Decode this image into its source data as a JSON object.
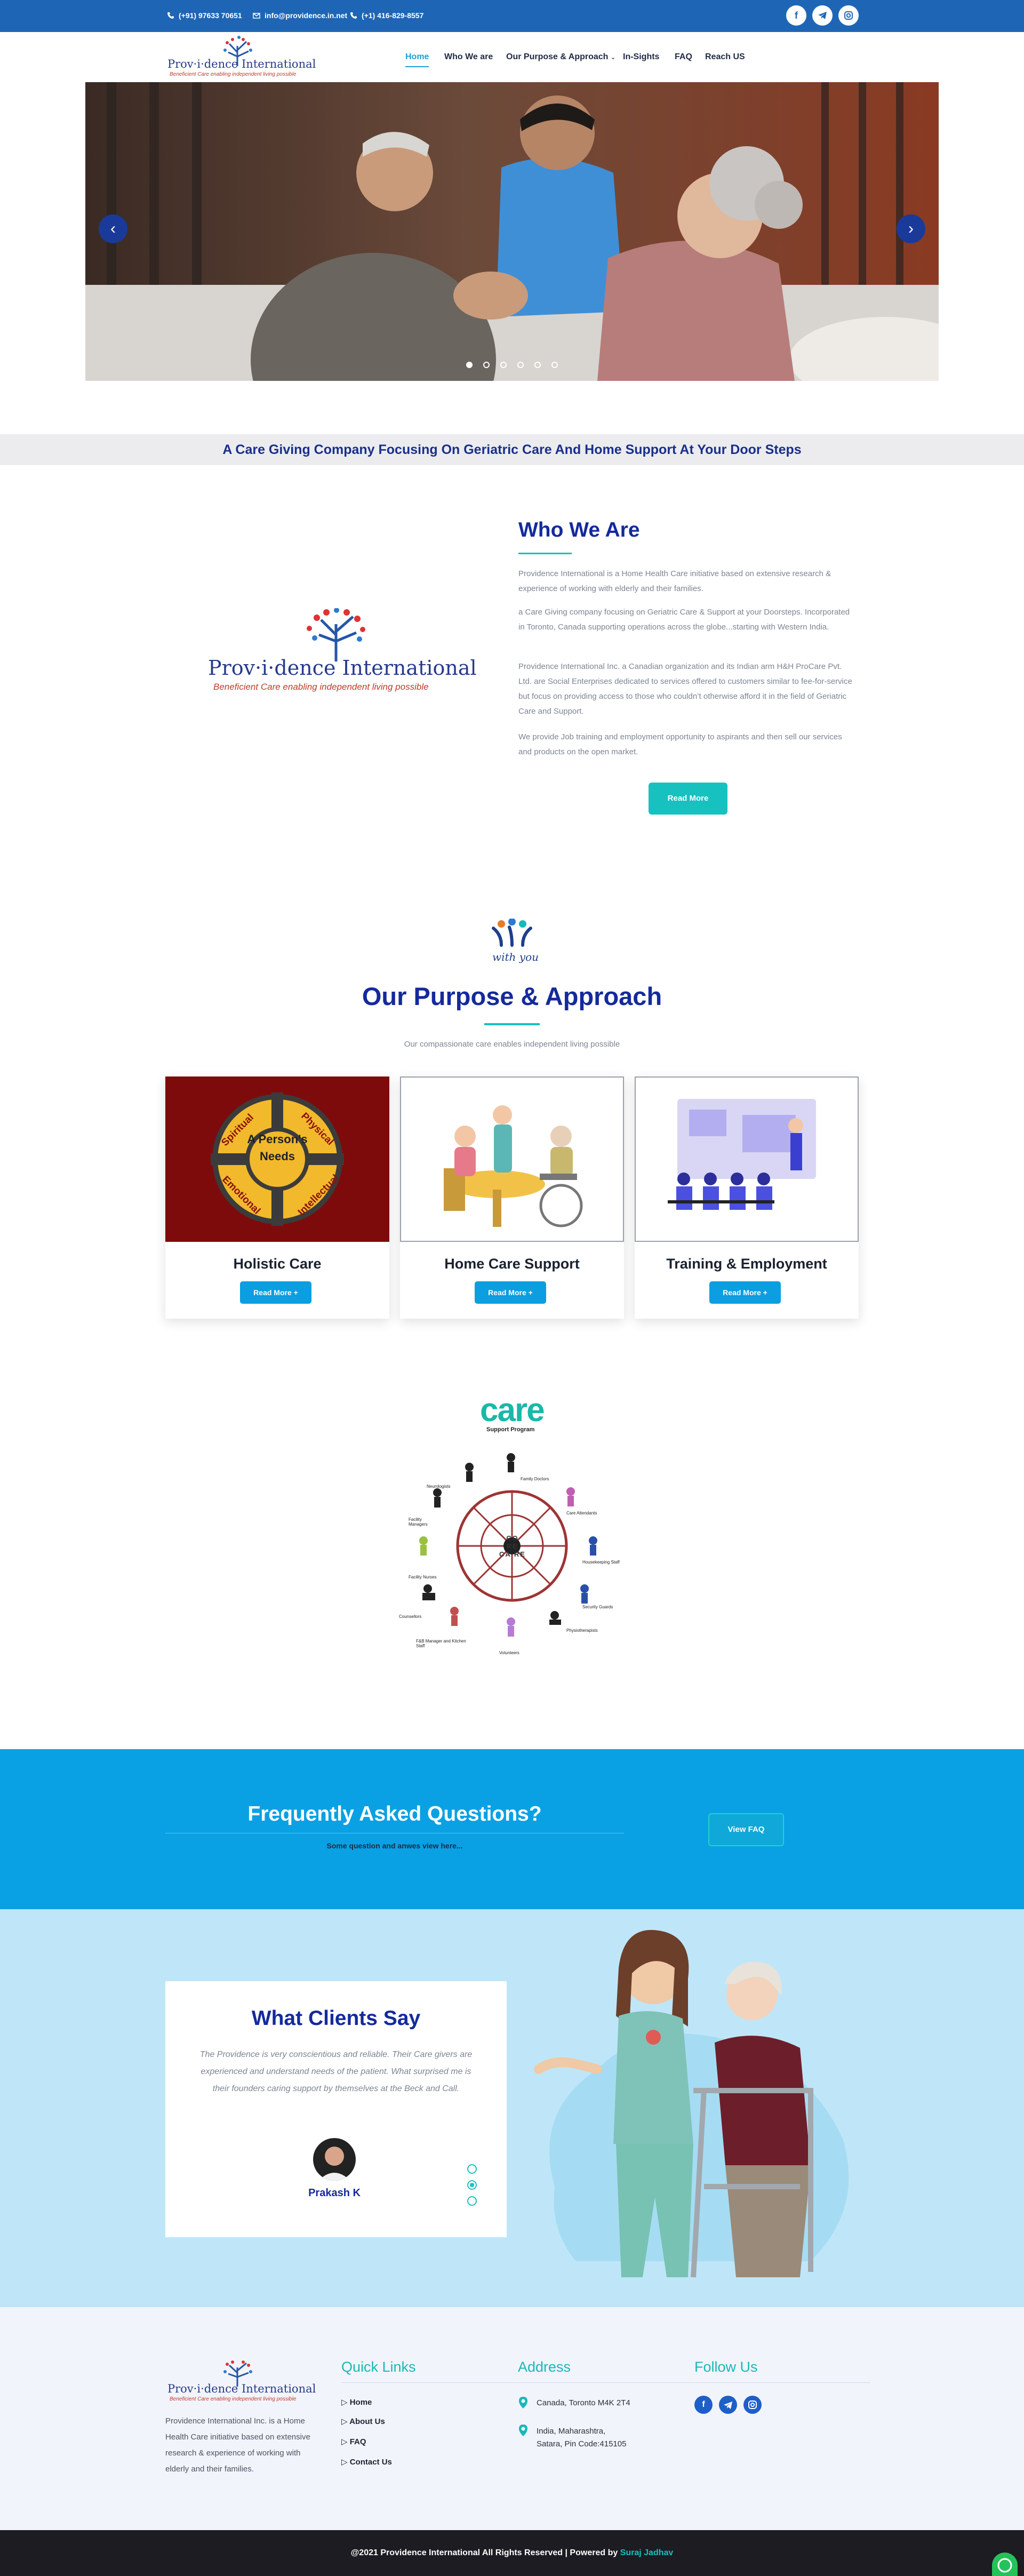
{
  "topbar": {
    "phone1": "(+91) 97633 70651",
    "email": "info@providence.in.net",
    "phone2": "(+1) 416-829-8557",
    "social_icons": [
      "facebook-icon",
      "telegram-icon",
      "instagram-icon"
    ]
  },
  "brand": {
    "logo_name": "Prov·i·dence International",
    "logo_tagline": "Beneficient Care enabling independent living possible"
  },
  "nav": {
    "items": [
      {
        "label": "Home",
        "active": true
      },
      {
        "label": "Who We are"
      },
      {
        "label": "Our Purpose & Approach"
      },
      {
        "label": "In-Sights"
      },
      {
        "label": "FAQ"
      },
      {
        "label": "Reach US"
      }
    ]
  },
  "hero": {
    "slides": 6,
    "active_slide": 1
  },
  "tagline": "A Care Giving Company Focusing On Geriatric Care And Home Support At Your Door Steps",
  "who": {
    "title": "Who We Are",
    "p1": "Providence International is a Home Health Care initiative based on extensive research & experience of working with elderly and their families.",
    "p2": "a Care Giving company focusing on Geriatric Care & Support at your Doorsteps. Incorporated in Toronto, Canada supporting operations across the globe...starting with Western India.",
    "p3": "Providence International Inc. a Canadian organization and its Indian arm H&H ProCare Pvt. Ltd. are Social Enterprises dedicated to services offered to customers similar to fee-for-service but focus on providing access to those who couldn’t otherwise afford it in the field of Geriatric Care and Support.",
    "p4": "We provide Job training and employment opportunity to aspirants and then sell our services and products on the open market.",
    "button": "Read More"
  },
  "purpose": {
    "icon_caption": "with you",
    "title": "Our Purpose & Approach",
    "subtitle": "Our compassionate care enables independent living possible",
    "wheel": {
      "center": "A Person's Needs",
      "segments": [
        "Spiritual",
        "Physical",
        "Emotional",
        "Intellectual"
      ]
    },
    "cards": [
      {
        "title": "Holistic Care",
        "button": "Read More +"
      },
      {
        "title": "Home Care Support",
        "button": "Read More +"
      },
      {
        "title": "Training & Employment",
        "button": "Read More +"
      }
    ]
  },
  "care_program": {
    "word": "care",
    "subtitle": "Support Program",
    "center": "CO RE CA RE",
    "roles": [
      "Neurologists",
      "Family Doctors",
      "Care Attendants",
      "Facility Managers",
      "Housekeeping Staff",
      "Security Guards",
      "Physiotherapists",
      "Volunteers",
      "F&B Manager and Kitchen Staff",
      "Counsellors",
      "Facility Nurses"
    ]
  },
  "faq": {
    "title": "Frequently Asked Questions?",
    "subtitle": "Some question and anwes view here...",
    "button": "View FAQ"
  },
  "testimonial": {
    "title": "What Clients Say",
    "quote": "The Providence is very conscientious and reliable. Their Care givers are experienced and understand needs of the patient. What surprised me is their founders caring support by themselves at the Beck and Call.",
    "name": "Prakash K",
    "dots": 3,
    "active_dot": 2
  },
  "footer": {
    "about": "Providence International Inc. is a Home Health Care initiative based on extensive research & experience of working with elderly and their families.",
    "quick_links_title": "Quick Links",
    "links": [
      "Home",
      "About Us",
      "FAQ",
      "Contact Us"
    ],
    "address_title": "Address",
    "address1": "Canada, Toronto M4K 2T4",
    "address2_line1": "India, Maharashtra,",
    "address2_line2": "Satara, Pin Code:415105",
    "follow_title": "Follow Us",
    "copyright": "@2021 Providence International All Rights Reserved | Powered by",
    "powered_by": "Suraj Jadhav"
  },
  "colors": {
    "primary": "#1e66b5",
    "navy": "#142a9c",
    "teal": "#17c1c0",
    "sky": "#0aa1e4",
    "dark": "#1c1c22"
  }
}
